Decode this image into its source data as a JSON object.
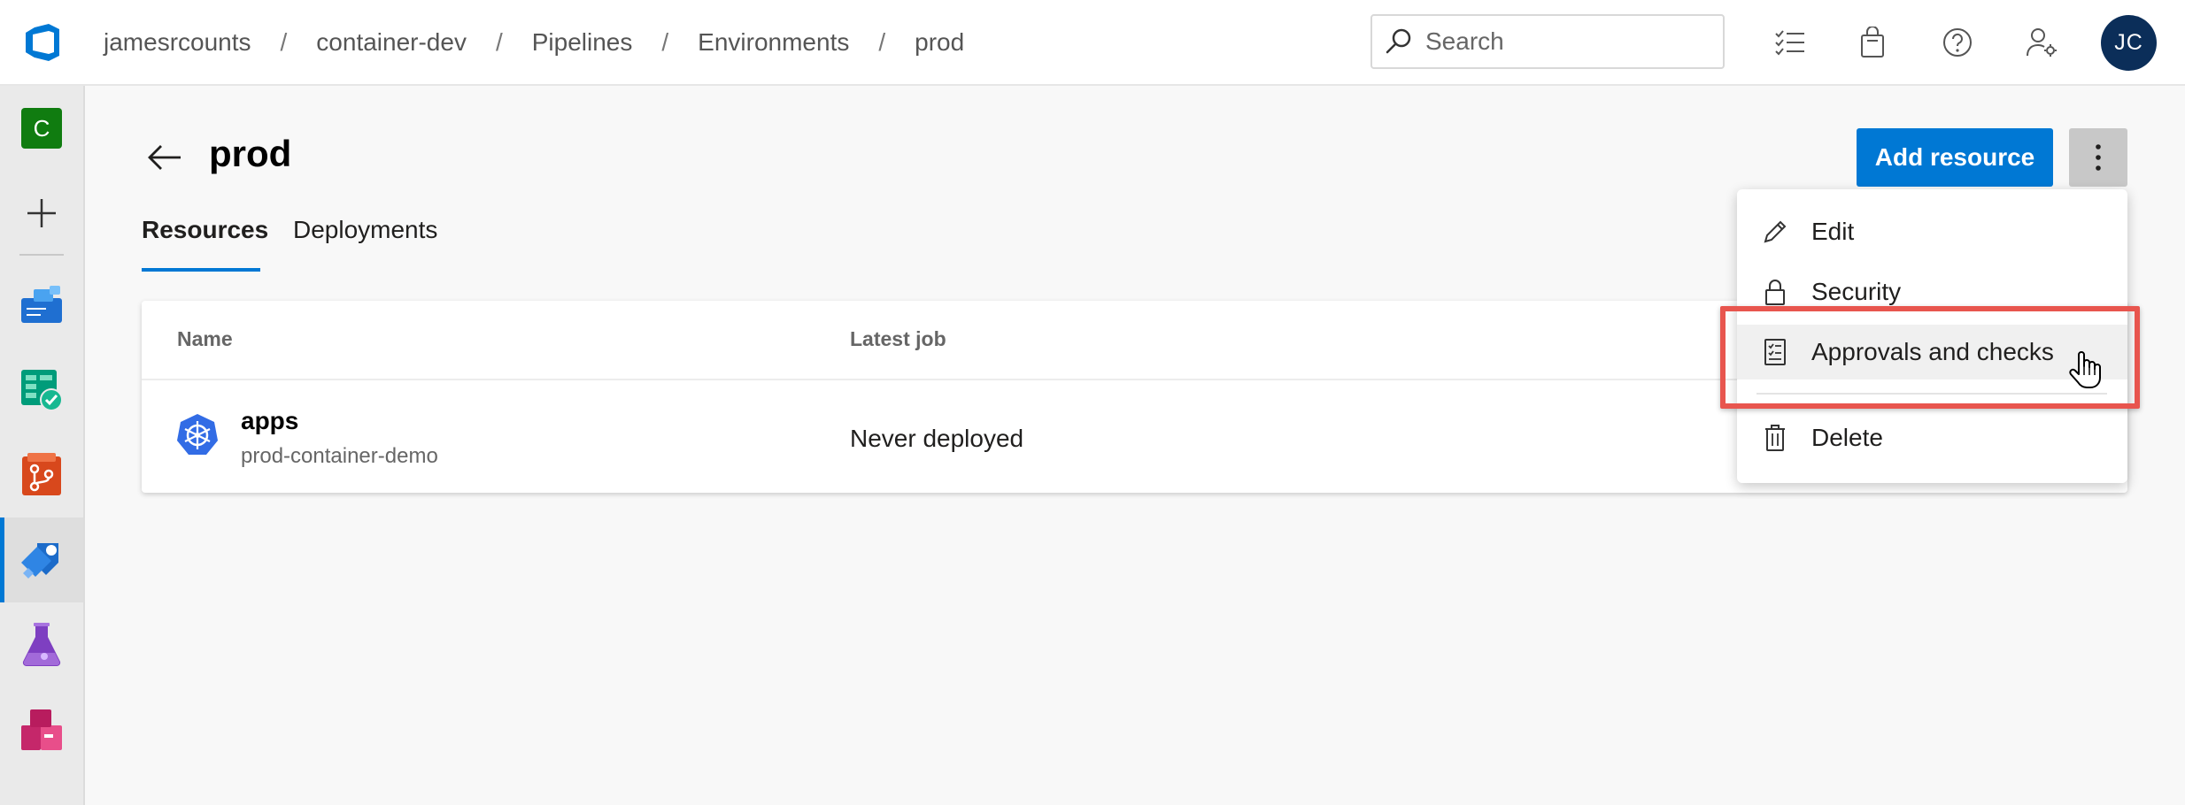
{
  "topbar": {
    "logo_icon": "azure-devops-logo-icon",
    "breadcrumb": [
      {
        "label": "jamesrcounts"
      },
      {
        "label": "container-dev"
      },
      {
        "label": "Pipelines"
      },
      {
        "label": "Environments"
      },
      {
        "label": "prod"
      }
    ],
    "breadcrumb_separator": "/",
    "search": {
      "placeholder": "Search",
      "value": "",
      "icon": "search-icon"
    },
    "icons": [
      "work-items-icon",
      "marketplace-bag-icon",
      "help-icon",
      "user-settings-icon"
    ],
    "avatar_initials": "JC"
  },
  "leftrail": {
    "project_initial": "C",
    "add_icon": "plus-icon",
    "items": [
      {
        "name": "overview",
        "icon": "overview-icon"
      },
      {
        "name": "boards",
        "icon": "boards-icon"
      },
      {
        "name": "repos",
        "icon": "repos-icon"
      },
      {
        "name": "pipelines",
        "icon": "pipelines-icon",
        "active": true
      },
      {
        "name": "test-plans",
        "icon": "test-plans-icon"
      },
      {
        "name": "artifacts",
        "icon": "artifacts-icon"
      }
    ]
  },
  "page": {
    "title": "prod",
    "back_icon": "back-arrow-icon",
    "add_resource_label": "Add resource",
    "more_icon": "more-vertical-icon",
    "tabs": [
      {
        "label": "Resources",
        "active": true
      },
      {
        "label": "Deployments",
        "active": false
      }
    ]
  },
  "table": {
    "columns": [
      "Name",
      "Latest job"
    ],
    "rows": [
      {
        "name": "apps",
        "subtitle": "prod-container-demo",
        "latest_job": "Never deployed",
        "icon": "kubernetes-icon"
      }
    ]
  },
  "menu": {
    "items": [
      {
        "label": "Edit",
        "icon": "pencil-icon"
      },
      {
        "label": "Security",
        "icon": "lock-icon"
      },
      {
        "label": "Approvals and checks",
        "icon": "checklist-icon",
        "highlighted": true
      },
      {
        "label": "Delete",
        "icon": "trash-icon"
      }
    ],
    "highlight_color": "#e8554e"
  },
  "colors": {
    "accent": "#0078d4",
    "avatar_bg": "#0b2e59",
    "project_badge": "#107c10"
  }
}
